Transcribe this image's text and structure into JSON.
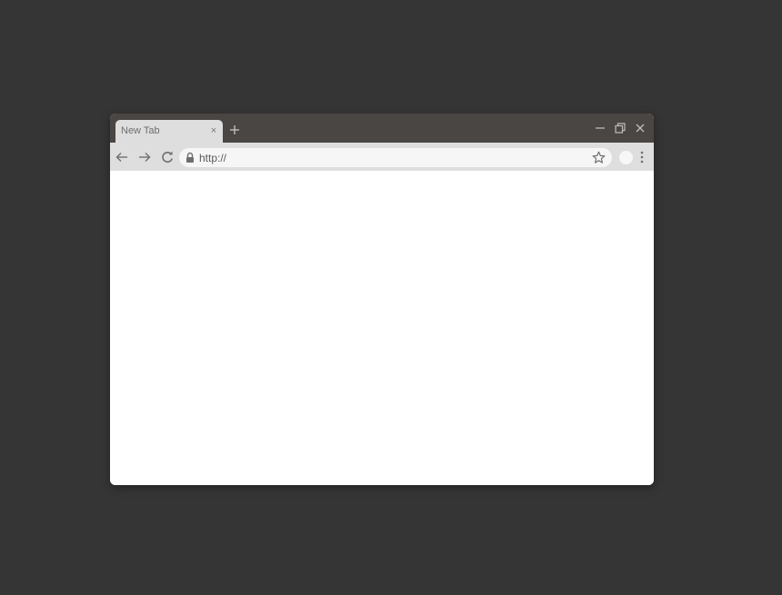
{
  "tab": {
    "title": "New Tab",
    "close_label": "×"
  },
  "address_bar": {
    "url": "http://",
    "lock_icon": "lock-icon",
    "bookmark_icon": "star-icon"
  },
  "toolbar": {
    "back_icon": "arrow-left-icon",
    "forward_icon": "arrow-right-icon",
    "reload_icon": "reload-icon",
    "menu_icon": "kebab-menu-icon",
    "profile_icon": "avatar"
  },
  "window_controls": {
    "minimize_icon": "minimize-icon",
    "restore_icon": "restore-icon",
    "close_icon": "close-icon"
  },
  "colors": {
    "desktop": "#353535",
    "titlebar": "#4a4644",
    "toolbar": "#dedede",
    "omnibox": "#f6f6f6",
    "content": "#ffffff"
  }
}
